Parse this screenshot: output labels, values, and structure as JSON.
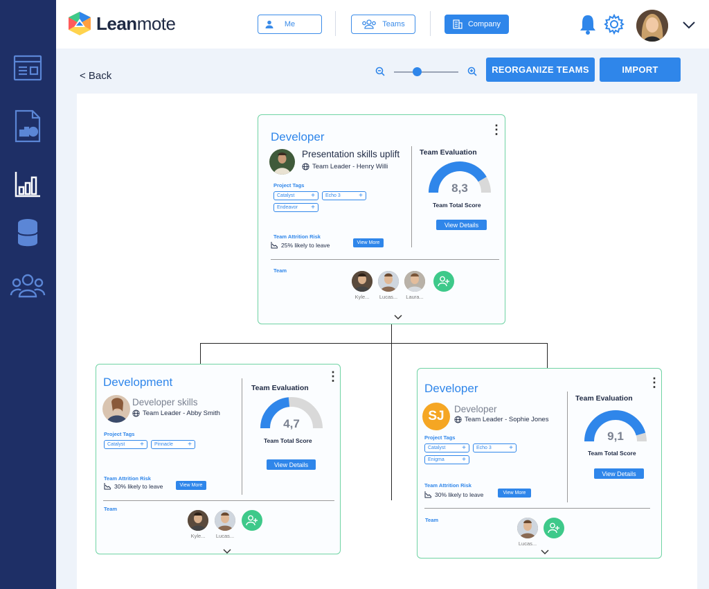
{
  "brand": {
    "name_bold": "Lean",
    "name_light": "mote"
  },
  "nav": {
    "me": "Me",
    "teams": "Teams",
    "company": "Company"
  },
  "toolbar": {
    "back": "< Back",
    "reorganize": "REORGANIZE TEAMS",
    "import": "IMPORT"
  },
  "zoom": {
    "level": 0.35
  },
  "colors": {
    "accent": "#2f86ea",
    "sidebar": "#1e2f66",
    "border": "#6fd3a3",
    "add": "#3ec98a",
    "gauge_empty": "#d9d9d9"
  },
  "cards": {
    "top": {
      "title": "Developer",
      "project": "Presentation skills uplift",
      "leader": "Team Leader - Henry Willi",
      "tags_label": "Project Tags",
      "tags": [
        "Catalyst",
        "Echo 3",
        "Endeavor"
      ],
      "attrition_label": "Team Attrition Risk",
      "attrition": "25% likely to leave",
      "view_more": "View More",
      "eval_title": "Team Evaluation",
      "score": "8,3",
      "score_fraction": 0.83,
      "score_label": "Team Total Score",
      "view_details": "View Details",
      "team_label": "Team",
      "members": [
        "Kyle...",
        "Lucas...",
        "Laura..."
      ]
    },
    "left": {
      "title": "Development",
      "project": "Developer skills",
      "leader": "Team Leader - Abby Smith",
      "tags_label": "Project Tags",
      "tags": [
        "Catalyst",
        "Pinnacle"
      ],
      "attrition_label": "Team Attrition Risk",
      "attrition": "30% likely to leave",
      "view_more": "View More",
      "eval_title": "Team Evaluation",
      "score": "4,7",
      "score_fraction": 0.47,
      "score_label": "Team Total Score",
      "view_details": "View Details",
      "team_label": "Team",
      "members": [
        "Kyle...",
        "Lucas..."
      ]
    },
    "right": {
      "title": "Developer",
      "initials": "SJ",
      "project": "Developer",
      "leader": "Team Leader - Sophie Jones",
      "tags_label": "Project Tags",
      "tags": [
        "Catalyst",
        "Echo 3",
        "Enigma"
      ],
      "attrition_label": "Team Attrition Risk",
      "attrition": "30% likely to leave",
      "view_more": "View More",
      "eval_title": "Team Evaluation",
      "score": "9,1",
      "score_fraction": 0.91,
      "score_label": "Team Total Score",
      "view_details": "View Details",
      "team_label": "Team",
      "members": [
        "Lucas..."
      ]
    }
  }
}
